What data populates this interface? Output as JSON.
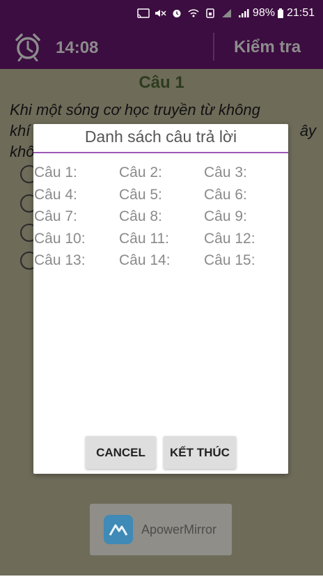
{
  "status_bar": {
    "battery": "98%",
    "clock": "21:51",
    "icons": [
      "cast-icon",
      "mute-icon",
      "alarm-icon",
      "wifi-call-icon",
      "sim-icon",
      "signal-icon",
      "signal-icon",
      "battery-icon"
    ]
  },
  "app_bar": {
    "timer": "14:08",
    "check_label": "Kiểm tra",
    "background_color": "#3c0d40"
  },
  "question": {
    "title": "Câu 1",
    "text_line1": "Khi một sóng cơ học truyền từ không",
    "text_line2_left": "khí",
    "text_line2_right": "ây",
    "text_line3": "khô"
  },
  "dialog": {
    "title": "Danh sách câu trả lời",
    "answers": [
      [
        "Câu 1:",
        "Câu 2:",
        "Câu 3:"
      ],
      [
        "Câu 4:",
        "Câu 5:",
        "Câu 6:"
      ],
      [
        "Câu 7:",
        "Câu 8:",
        "Câu 9:"
      ],
      [
        "Câu 10:",
        "Câu 11:",
        "Câu 12:"
      ],
      [
        "Câu 13:",
        "Câu 14:",
        "Câu 15:"
      ]
    ],
    "cancel_label": "CANCEL",
    "finish_label": "KẾT THÚC",
    "accent_color": "#9b59b6"
  },
  "overlay_app": {
    "label": "ApowerMirror"
  }
}
